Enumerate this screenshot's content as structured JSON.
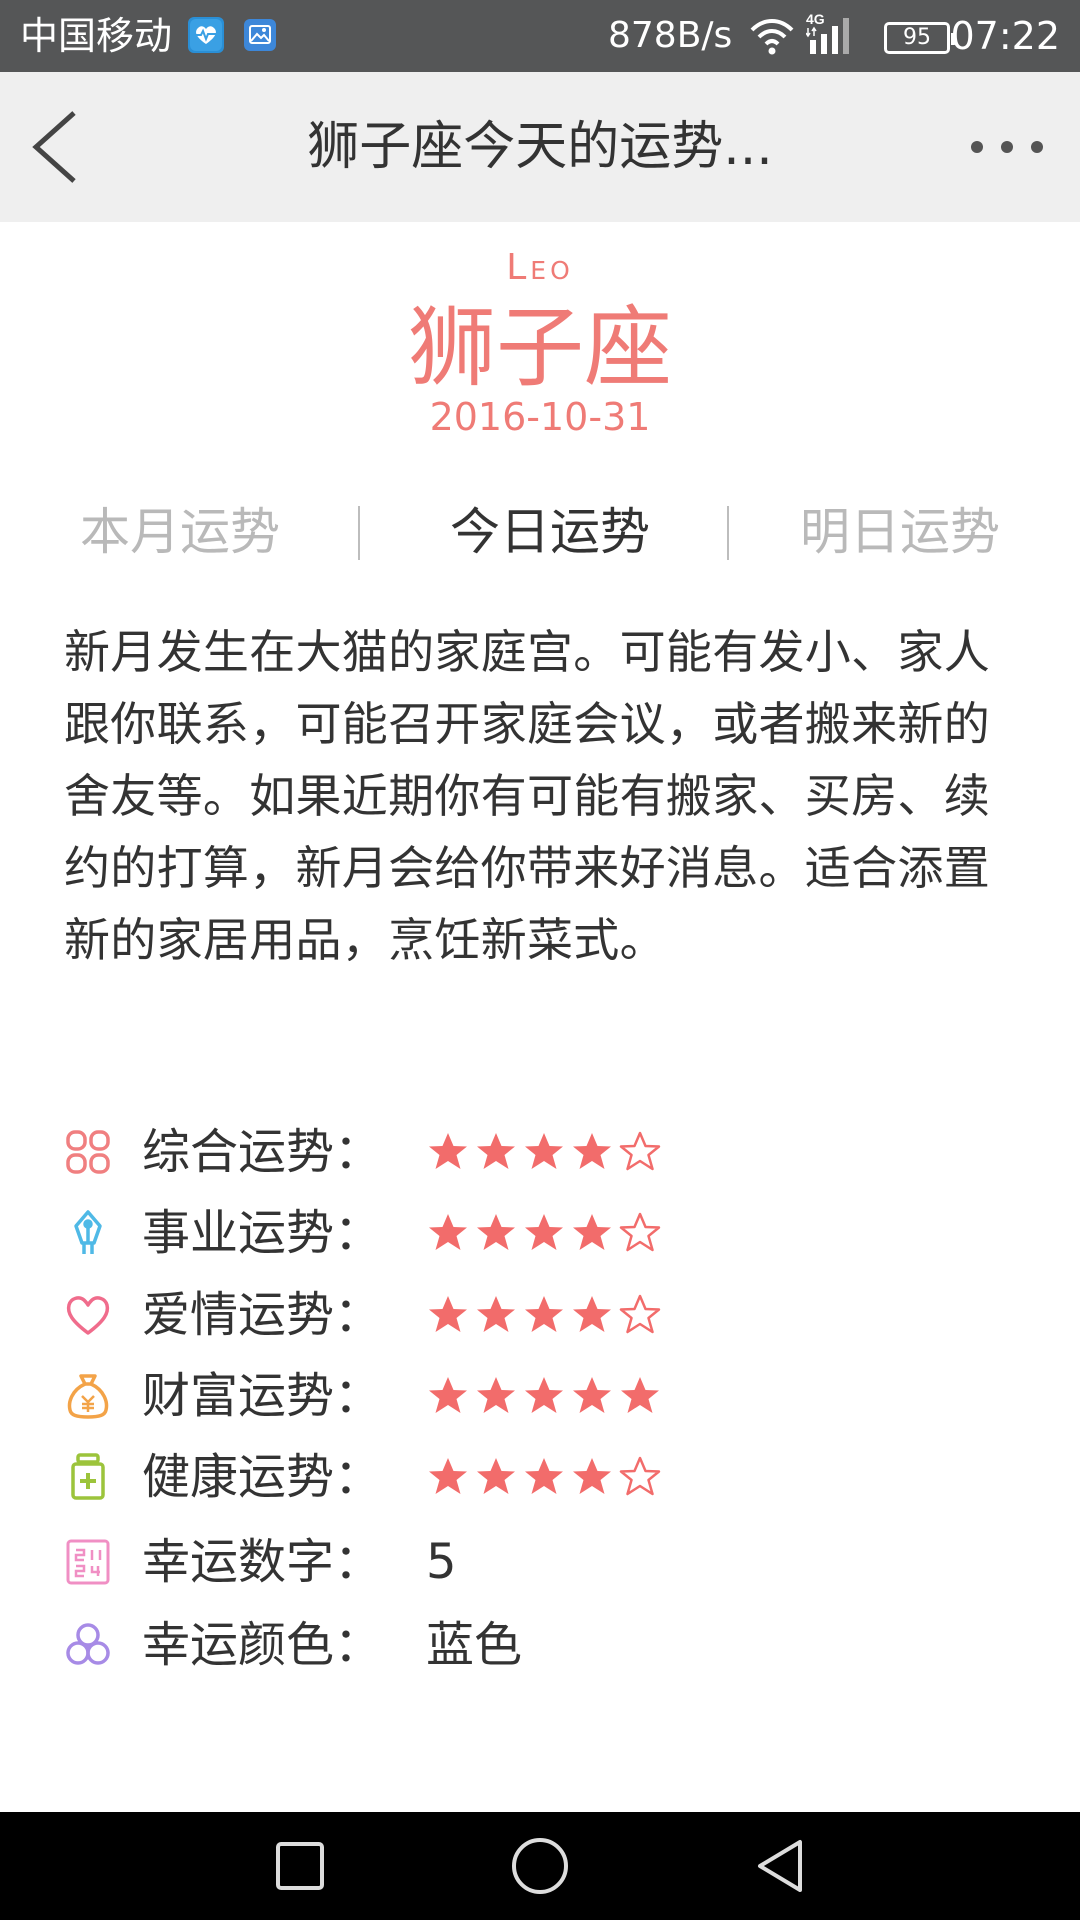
{
  "status_bar": {
    "carrier": "中国移动",
    "net_speed": "878B/s",
    "network_type": "4G",
    "battery": "95",
    "time": "07:22",
    "icons": [
      "health-app-icon",
      "gallery-app-icon",
      "wifi-icon",
      "signal-icon",
      "battery-icon"
    ]
  },
  "title_bar": {
    "title": "狮子座今天的运势...",
    "back_icon": "chevron-left-icon",
    "more_icon": "more-dots-icon"
  },
  "sign": {
    "en": "Leo",
    "cn": "狮子座",
    "date": "2016-10-31",
    "color": "#ef7b76"
  },
  "tabs": [
    {
      "label": "本月运势",
      "active": false
    },
    {
      "label": "今日运势",
      "active": true
    },
    {
      "label": "明日运势",
      "active": false
    }
  ],
  "description": "新月发生在大猫的家庭宫。可能有发小、家人跟你联系，可能召开家庭会议，或者搬来新的舍友等。如果近期你有可能有搬家、买房、续约的打算，新月会给你带来好消息。适合添置新的家居用品，烹饪新菜式。",
  "fortunes": [
    {
      "label": "综合运势：",
      "icon": "grid-icon",
      "icon_color": "#f07f80",
      "rating": 4,
      "max": 5
    },
    {
      "label": "事业运势：",
      "icon": "pen-nib-icon",
      "icon_color": "#4fb9e6",
      "rating": 4,
      "max": 5
    },
    {
      "label": "爱情运势：",
      "icon": "heart-icon",
      "icon_color": "#f06c8c",
      "rating": 4,
      "max": 5
    },
    {
      "label": "财富运势：",
      "icon": "money-bag-icon",
      "icon_color": "#f3a348",
      "rating": 5,
      "max": 5
    },
    {
      "label": "健康运势：",
      "icon": "medicine-bottle-icon",
      "icon_color": "#9cc43b",
      "rating": 4,
      "max": 5
    }
  ],
  "lucky": [
    {
      "label": "幸运数字：",
      "value": "5",
      "icon": "calendar-number-icon",
      "icon_color": "#f08fc4"
    },
    {
      "label": "幸运颜色：",
      "value": "蓝色",
      "icon": "color-circles-icon",
      "icon_color": "#a78be6"
    }
  ],
  "star_color": "#f26c6b",
  "nav_bar": {
    "icons": [
      "recent-apps-square-icon",
      "home-circle-icon",
      "back-triangle-icon"
    ]
  }
}
